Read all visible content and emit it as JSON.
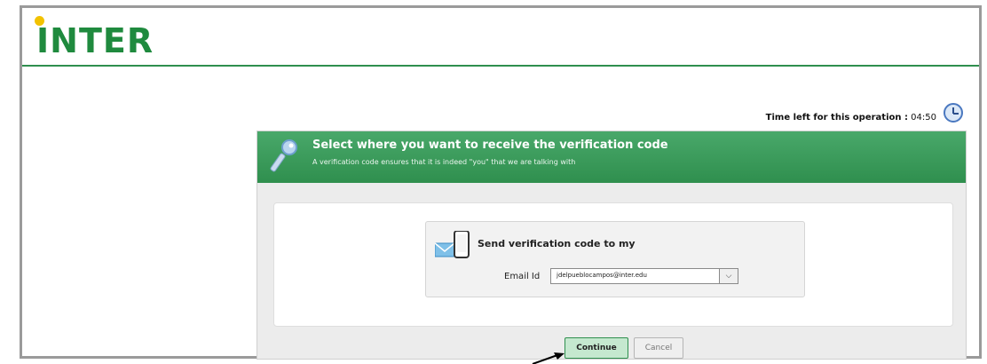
{
  "header": {
    "logo_text": "INTER"
  },
  "timer": {
    "label": "Time left for this operation :",
    "value": "04:50"
  },
  "banner": {
    "title": "Select where you want to receive the verification code",
    "subtitle": "A verification code ensures that it is indeed \"you\" that we are talking with"
  },
  "verification": {
    "send_label": "Send verification code to my",
    "email_label": "Email Id",
    "email_value": "jdelpueblocampos@inter.edu"
  },
  "buttons": {
    "continue": "Continue",
    "cancel": "Cancel"
  },
  "icons": {
    "logo": "inter-logo",
    "timer": "clock-icon",
    "banner": "key-icon",
    "device": "phone-email-icon",
    "dropdown": "chevron-down-icon"
  },
  "colors": {
    "brand_green": "#2f8f4e",
    "logo_dot": "#f2c200"
  }
}
